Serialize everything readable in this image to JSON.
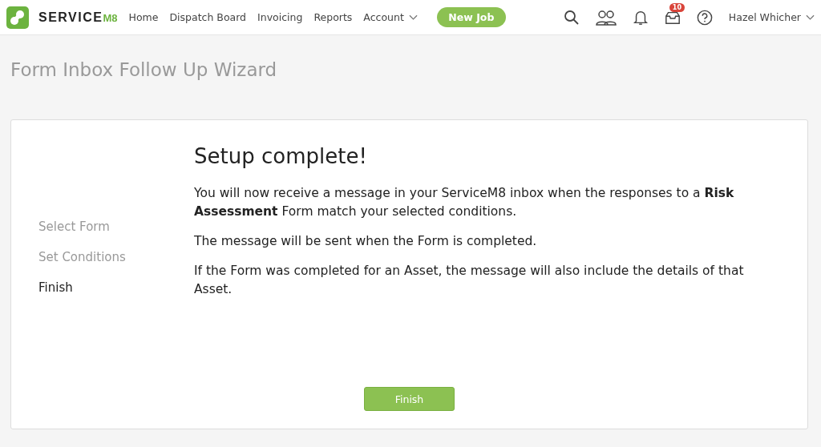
{
  "header": {
    "logo": {
      "name": "SERVICE",
      "suffix": "M8"
    },
    "nav": [
      {
        "label": "Home",
        "dropdown": false
      },
      {
        "label": "Dispatch Board",
        "dropdown": false
      },
      {
        "label": "Invoicing",
        "dropdown": false
      },
      {
        "label": "Reports",
        "dropdown": false
      },
      {
        "label": "Account",
        "dropdown": true
      }
    ],
    "new_job": "New Job",
    "inbox_badge": "10",
    "user": "Hazel Whicher"
  },
  "page_title": "Form Inbox Follow Up Wizard",
  "steps": [
    {
      "label": "Select Form",
      "selected": false
    },
    {
      "label": "Set Conditions",
      "selected": false
    },
    {
      "label": "Finish",
      "selected": true
    }
  ],
  "content": {
    "heading": "Setup complete!",
    "paragraphs": [
      "You will now receive a message in your ServiceM8 inbox when the responses to a **Risk Assessment** Form match your selected conditions.",
      "The message will be sent when the Form is completed.",
      "If the Form was completed for an Asset, the message will also include the details of that Asset."
    ],
    "button": "Finish"
  }
}
